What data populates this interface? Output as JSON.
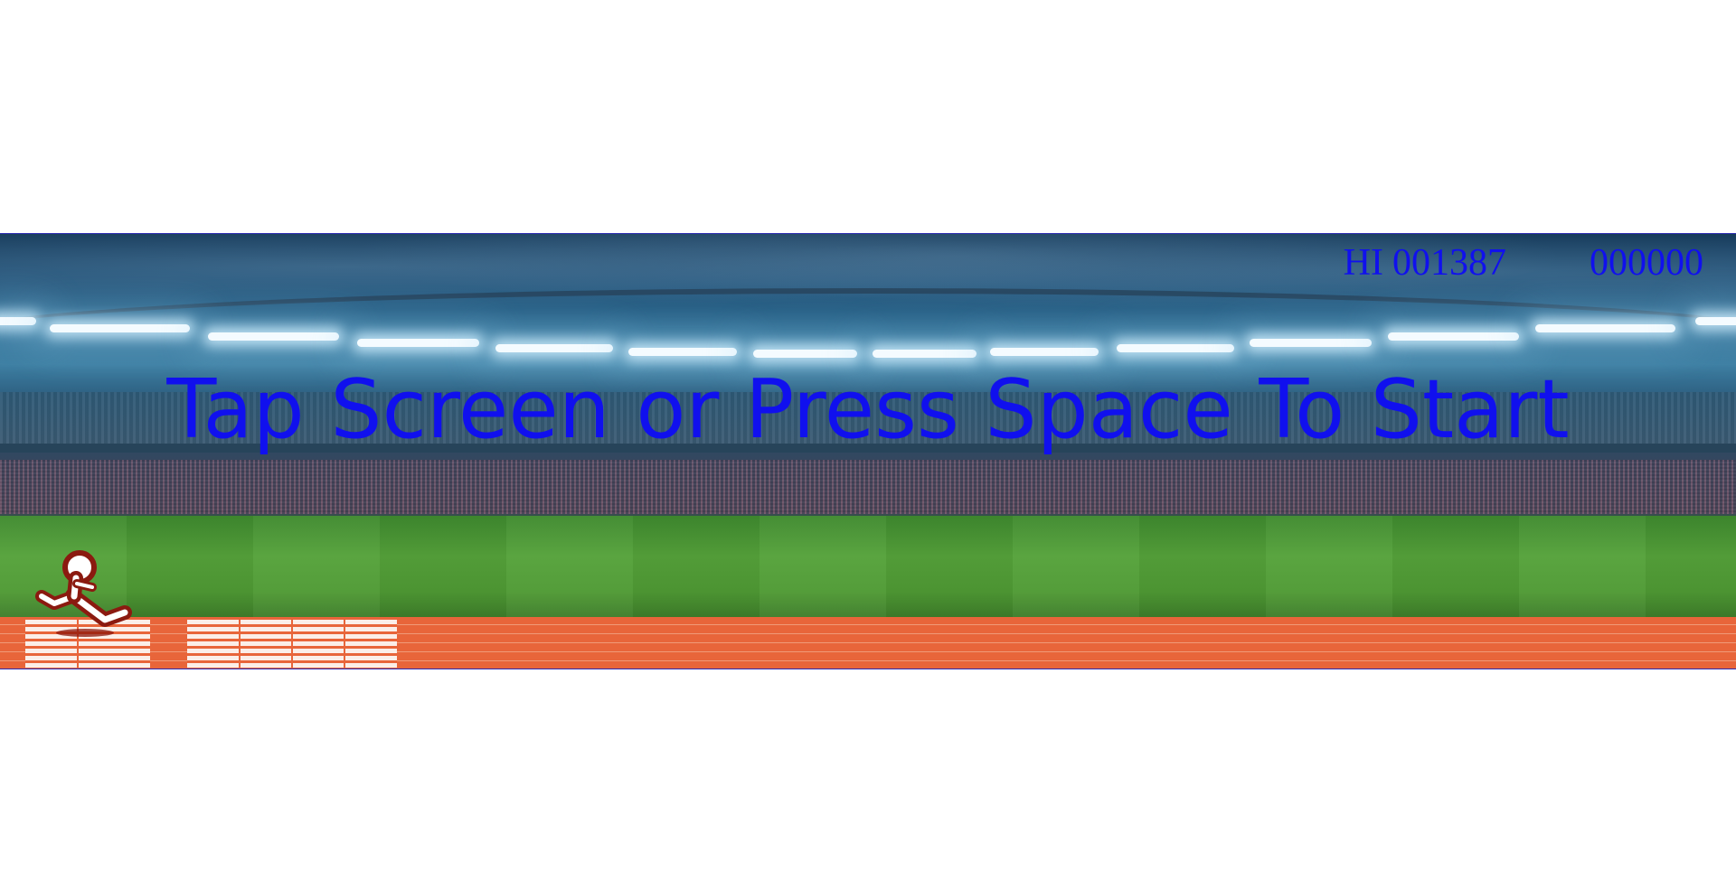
{
  "hud": {
    "hi_label": "HI",
    "hi_score": "001387",
    "current_score": "000000"
  },
  "overlay": {
    "start_message": "Tap Screen or Press Space To Start"
  },
  "colors": {
    "text": "#1010ee",
    "track": "#e8653a",
    "grass": "#4f9a34",
    "runner_outline": "#8b1a10"
  },
  "icons": {
    "runner": "runner-icon"
  }
}
